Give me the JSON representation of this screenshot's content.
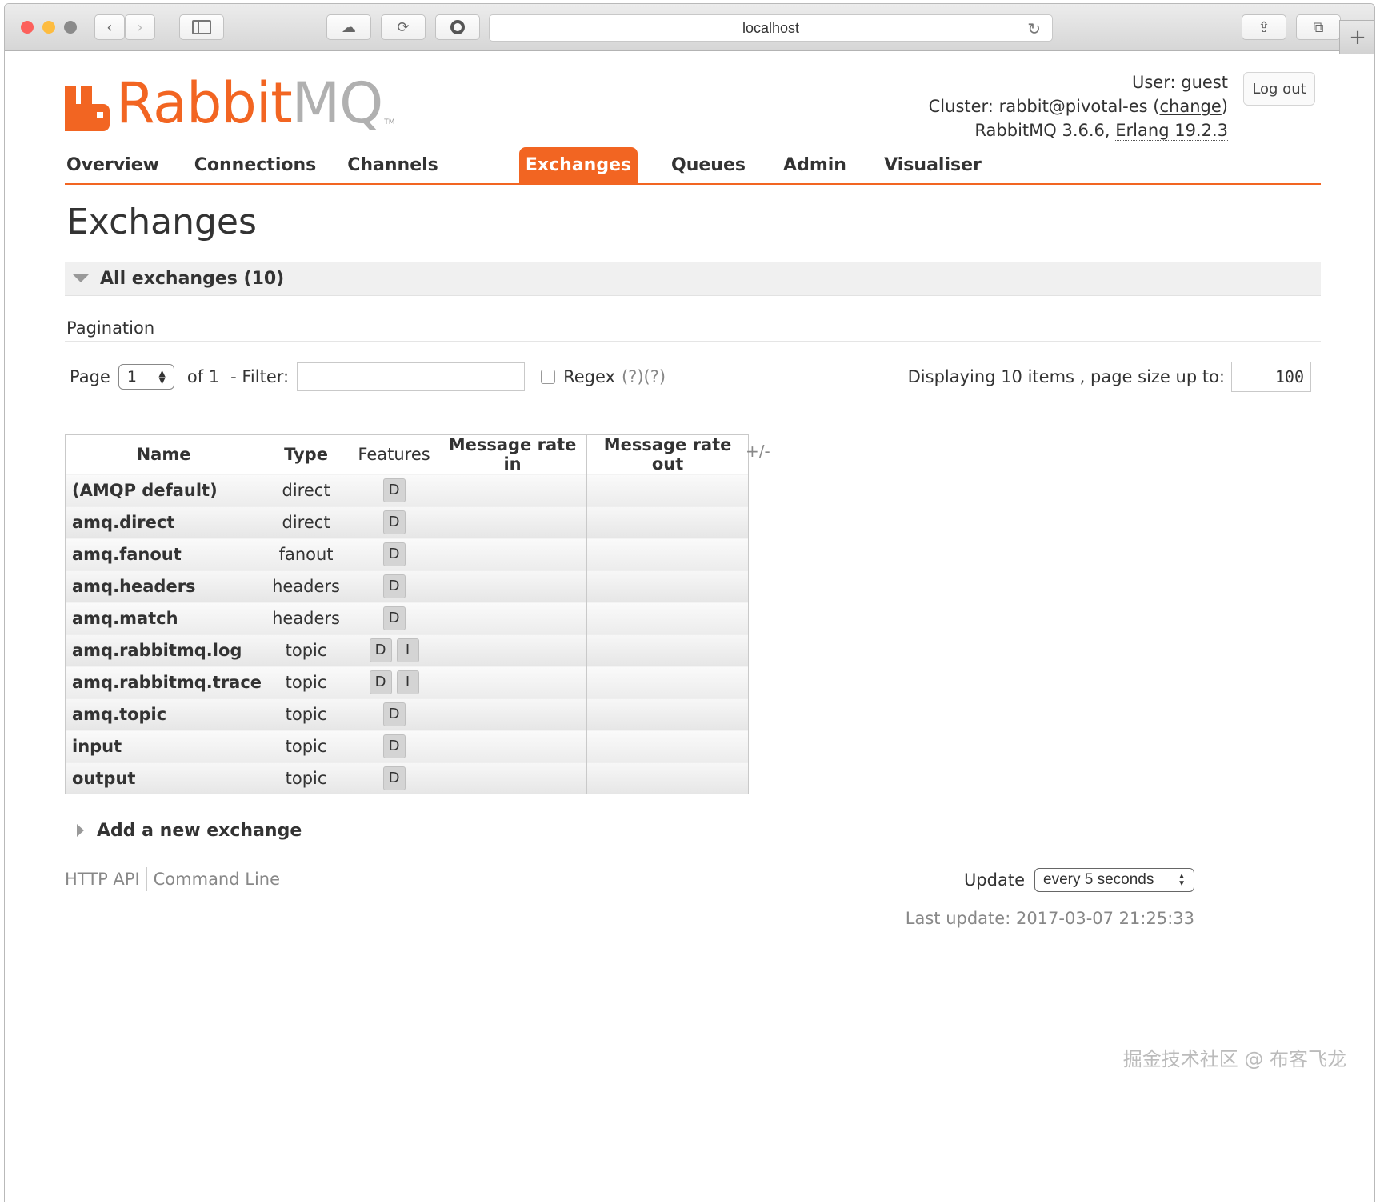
{
  "browser": {
    "address": "localhost",
    "traffic_colors": [
      "#fc605c",
      "#fdbc40",
      "#8a8a8a"
    ]
  },
  "header": {
    "logo_text": "Rabbit",
    "logo_text_mq": "MQ",
    "logo_tm": "TM",
    "user_label": "User:",
    "user": "guest",
    "cluster_label": "Cluster:",
    "cluster": "rabbit@pivotal-es",
    "change_link": "change",
    "version_text": "RabbitMQ 3.6.6,",
    "erlang": "Erlang 19.2.3",
    "logout": "Log out"
  },
  "colors": {
    "accent": "#f26522"
  },
  "nav": {
    "tabs": [
      {
        "label": "Overview"
      },
      {
        "label": "Connections"
      },
      {
        "label": "Channels"
      },
      {
        "label": "Exchanges"
      },
      {
        "label": "Queues"
      },
      {
        "label": "Admin"
      },
      {
        "label": "Visualiser"
      }
    ],
    "active": "Exchanges"
  },
  "page": {
    "title": "Exchanges",
    "section_title": "All exchanges (10)",
    "pagination_label": "Pagination",
    "page_label": "Page",
    "page_value": "1",
    "of_label": "of 1",
    "filter_label": "- Filter:",
    "filter_value": "",
    "regex_label": "Regex",
    "regex_help": "(?)(?)",
    "displaying": "Displaying 10 items , page size up to:",
    "page_size": "100",
    "plus_minus": "+/-",
    "add_exchange": "Add a new exchange"
  },
  "table": {
    "headers": [
      "Name",
      "Type",
      "Features",
      "Message rate in",
      "Message rate out"
    ],
    "rows": [
      {
        "name": "(AMQP default)",
        "type": "direct",
        "features": [
          "D"
        ]
      },
      {
        "name": "amq.direct",
        "type": "direct",
        "features": [
          "D"
        ]
      },
      {
        "name": "amq.fanout",
        "type": "fanout",
        "features": [
          "D"
        ]
      },
      {
        "name": "amq.headers",
        "type": "headers",
        "features": [
          "D"
        ]
      },
      {
        "name": "amq.match",
        "type": "headers",
        "features": [
          "D"
        ]
      },
      {
        "name": "amq.rabbitmq.log",
        "type": "topic",
        "features": [
          "D",
          "I"
        ]
      },
      {
        "name": "amq.rabbitmq.trace",
        "type": "topic",
        "features": [
          "D",
          "I"
        ]
      },
      {
        "name": "amq.topic",
        "type": "topic",
        "features": [
          "D"
        ]
      },
      {
        "name": "input",
        "type": "topic",
        "features": [
          "D"
        ]
      },
      {
        "name": "output",
        "type": "topic",
        "features": [
          "D"
        ]
      }
    ]
  },
  "footer": {
    "http_api": "HTTP API",
    "command_line": "Command Line",
    "update_label": "Update",
    "update_value": "every 5 seconds",
    "last_update": "Last update: 2017-03-07 21:25:33"
  },
  "watermark": "掘金技术社区 @ 布客飞龙"
}
